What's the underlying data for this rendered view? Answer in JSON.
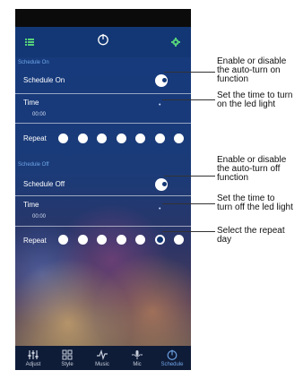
{
  "schedule_on": {
    "section_label": "Schedule On",
    "toggle_label": "Schedule On",
    "time_label": "Time",
    "time_value": "00:00",
    "repeat_label": "Repeat",
    "days_selected": [
      false,
      false,
      false,
      false,
      false,
      false,
      false
    ]
  },
  "schedule_off": {
    "section_label": "Schedule Off",
    "toggle_label": "Schedule Off",
    "time_label": "Time",
    "time_value": "00:00",
    "repeat_label": "Repeat",
    "days_selected": [
      false,
      false,
      false,
      false,
      false,
      true,
      false
    ]
  },
  "tabs": [
    {
      "label": "Adjust",
      "icon": "sliders-icon",
      "active": false
    },
    {
      "label": "Style",
      "icon": "grid-icon",
      "active": false
    },
    {
      "label": "Music",
      "icon": "music-icon",
      "active": false
    },
    {
      "label": "Mic",
      "icon": "mic-icon",
      "active": false
    },
    {
      "label": "Schedule",
      "icon": "timer-icon",
      "active": true
    }
  ],
  "annotations": {
    "on_toggle": [
      "Enable or disable",
      "the auto-turn on",
      "function"
    ],
    "on_time": [
      "Set the time to turn",
      "on the led light"
    ],
    "off_toggle": [
      "Enable or disable",
      "the auto-turn off",
      "function"
    ],
    "off_time": [
      "Set the time to",
      "turn off the led light"
    ],
    "repeat": [
      "Select the repeat",
      "day"
    ]
  },
  "colors": {
    "appbar": "#123774",
    "accent": "#6fa6e8",
    "tabbar": "#0f1c38"
  }
}
